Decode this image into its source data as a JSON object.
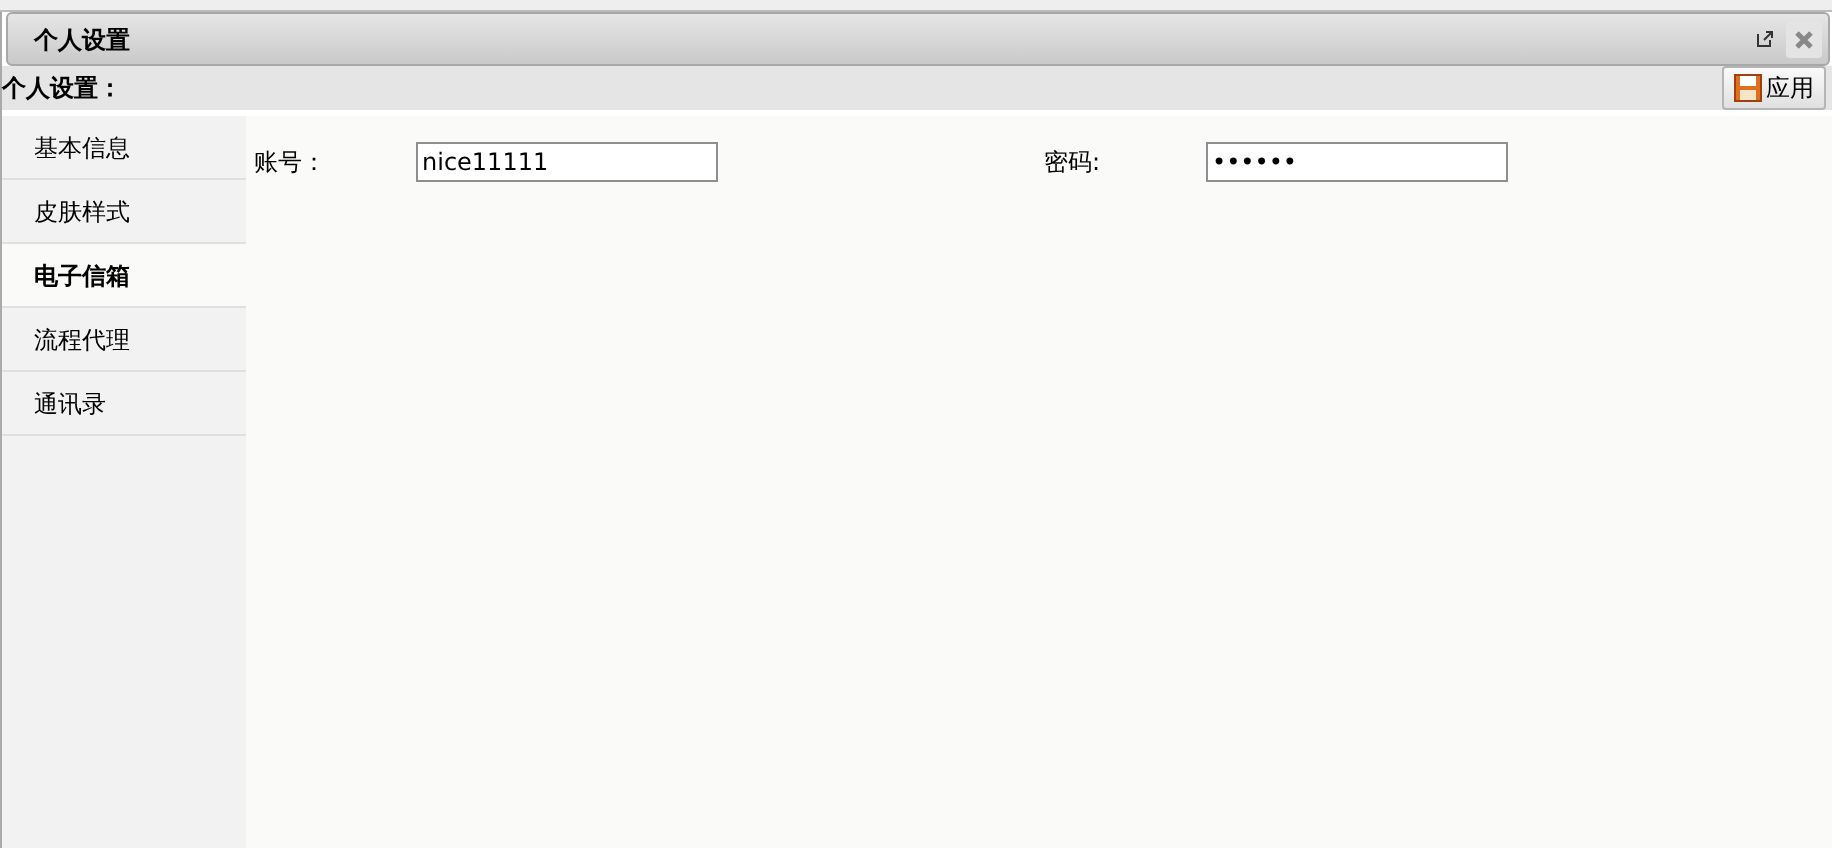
{
  "window": {
    "title": "个人设置"
  },
  "toolbar": {
    "title": "个人设置：",
    "apply_button": "应用"
  },
  "sidebar": {
    "items": [
      {
        "label": "基本信息",
        "selected": false
      },
      {
        "label": "皮肤样式",
        "selected": false
      },
      {
        "label": "电子信箱",
        "selected": true
      },
      {
        "label": "流程代理",
        "selected": false
      },
      {
        "label": "通讯录",
        "selected": false
      }
    ]
  },
  "form": {
    "fields": [
      {
        "label": "账号：",
        "value": "nice11111"
      },
      {
        "label": "密码:",
        "value": "••••••"
      }
    ]
  }
}
